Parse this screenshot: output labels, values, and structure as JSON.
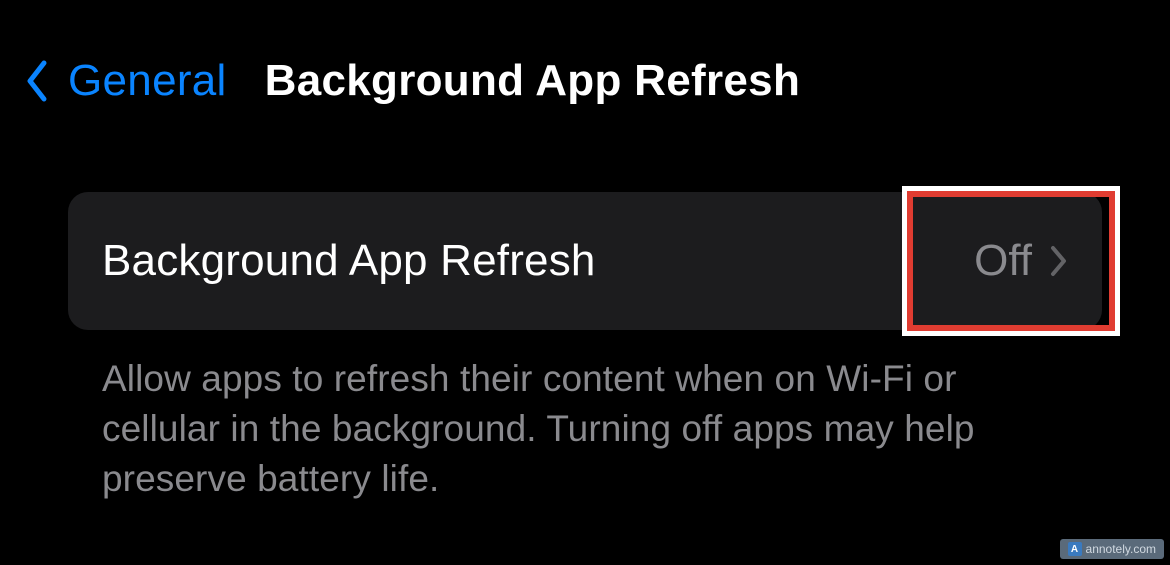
{
  "nav": {
    "back_label": "General",
    "page_title": "Background App Refresh"
  },
  "row": {
    "label": "Background App Refresh",
    "value": "Off"
  },
  "footer": {
    "text": "Allow apps to refresh their content when on Wi-Fi or cellular in the background. Turning off apps may help preserve battery life."
  },
  "annotation": {
    "highlight_color": "#e03c31"
  },
  "watermark": {
    "text": "annotely.com",
    "icon_letter": "A"
  }
}
